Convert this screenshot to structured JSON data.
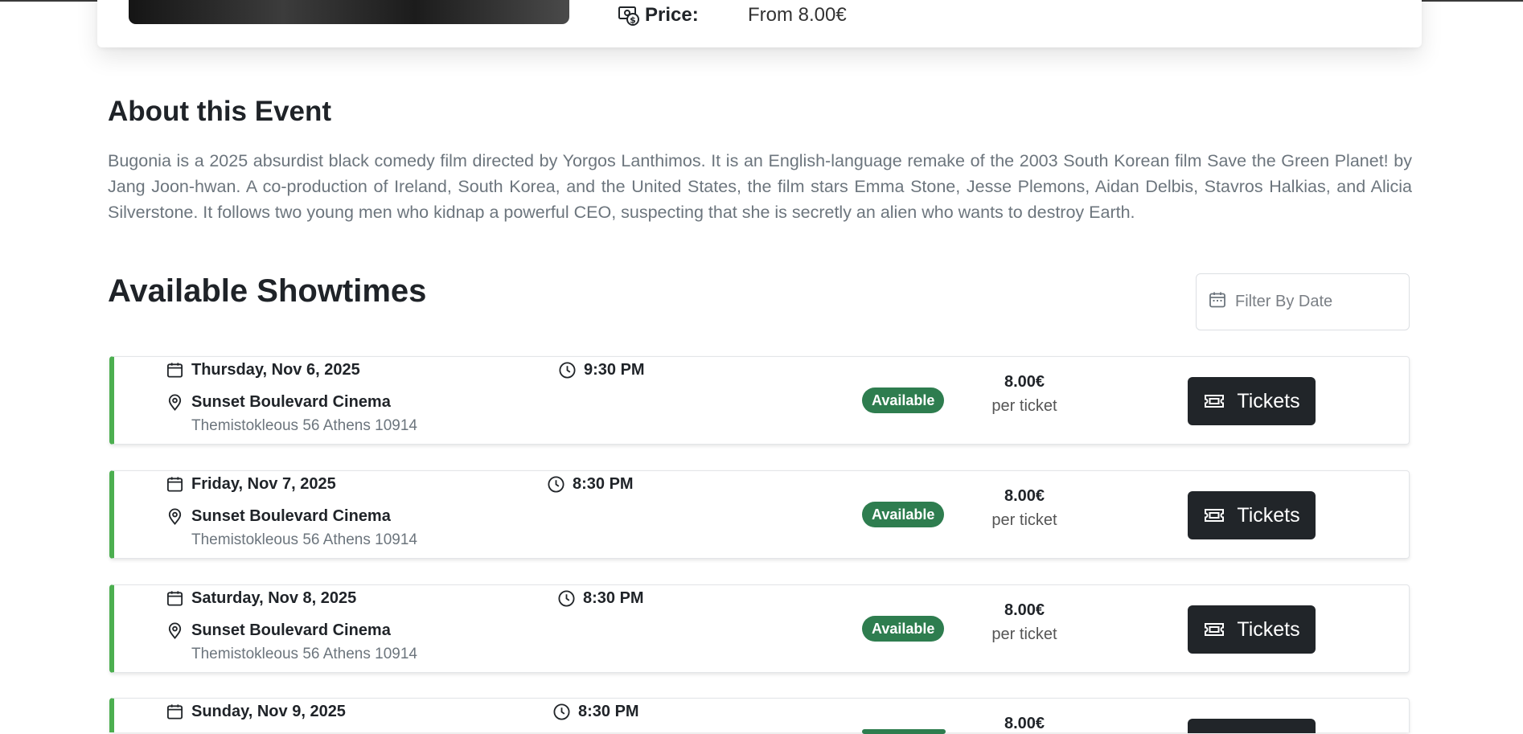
{
  "hero": {
    "price_label": "Price:",
    "price_value": "From 8.00€",
    "price_icon": "cash-coin-icon"
  },
  "about": {
    "title": "About this Event",
    "text": "Bugonia is a 2025 absurdist black comedy film directed by Yorgos Lanthimos. It is an English-language remake of the 2003 South Korean film Save the Green Planet! by Jang Joon-hwan. A co-production of Ireland, South Korea, and the United States, the film stars Emma Stone, Jesse Plemons, Aidan Delbis, Stavros Halkias, and Alicia Silverstone. It follows two young men who kidnap a powerful CEO, suspecting that she is secretly an alien who wants to destroy Earth."
  },
  "showtimes": {
    "title": "Available Showtimes",
    "filter_placeholder": "Filter By Date",
    "accent_color": "#4caf50",
    "badge_color": "#2e7d4f",
    "items": [
      {
        "date": "Thursday, Nov 6, 2025",
        "time": "9:30 PM",
        "venue": "Sunset Boulevard Cinema",
        "address": "Themistokleous 56 Athens 10914",
        "status": "Available",
        "price": "8.00€",
        "per": "per ticket",
        "button": "Tickets"
      },
      {
        "date": "Friday, Nov 7, 2025",
        "time": "8:30 PM",
        "venue": "Sunset Boulevard Cinema",
        "address": "Themistokleous 56 Athens 10914",
        "status": "Available",
        "price": "8.00€",
        "per": "per ticket",
        "button": "Tickets"
      },
      {
        "date": "Saturday, Nov 8, 2025",
        "time": "8:30 PM",
        "venue": "Sunset Boulevard Cinema",
        "address": "Themistokleous 56 Athens 10914",
        "status": "Available",
        "price": "8.00€",
        "per": "per ticket",
        "button": "Tickets"
      },
      {
        "date": "Sunday, Nov 9, 2025",
        "time": "8:30 PM",
        "price": "8.00€"
      }
    ]
  }
}
